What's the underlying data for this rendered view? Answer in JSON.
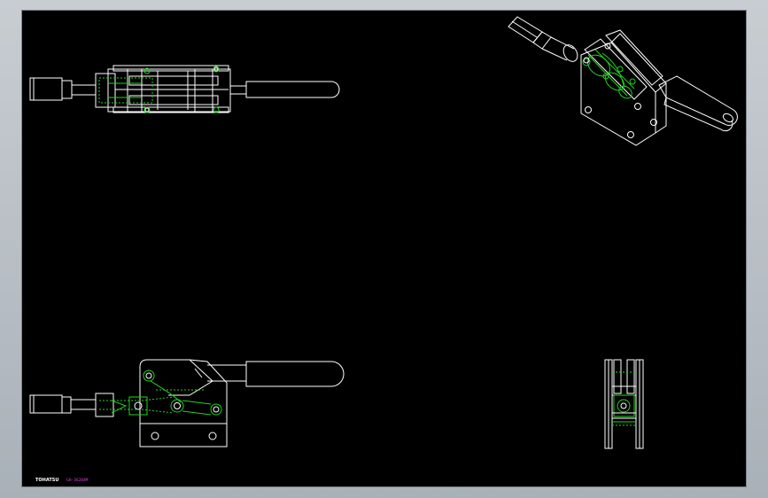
{
  "window": {
    "background_color": "#b4bbc1",
    "canvas_color": "#000000"
  },
  "drawing": {
    "line_colors": {
      "visible": "#ffffff",
      "detail": "#1fd31f",
      "annotation": "#e23de2"
    },
    "views": [
      {
        "name": "top-view"
      },
      {
        "name": "isometric-view"
      },
      {
        "name": "front-view"
      },
      {
        "name": "side-view"
      }
    ],
    "title_block": {
      "company": "TOHATSU",
      "part_number": "GH-36204M"
    }
  }
}
